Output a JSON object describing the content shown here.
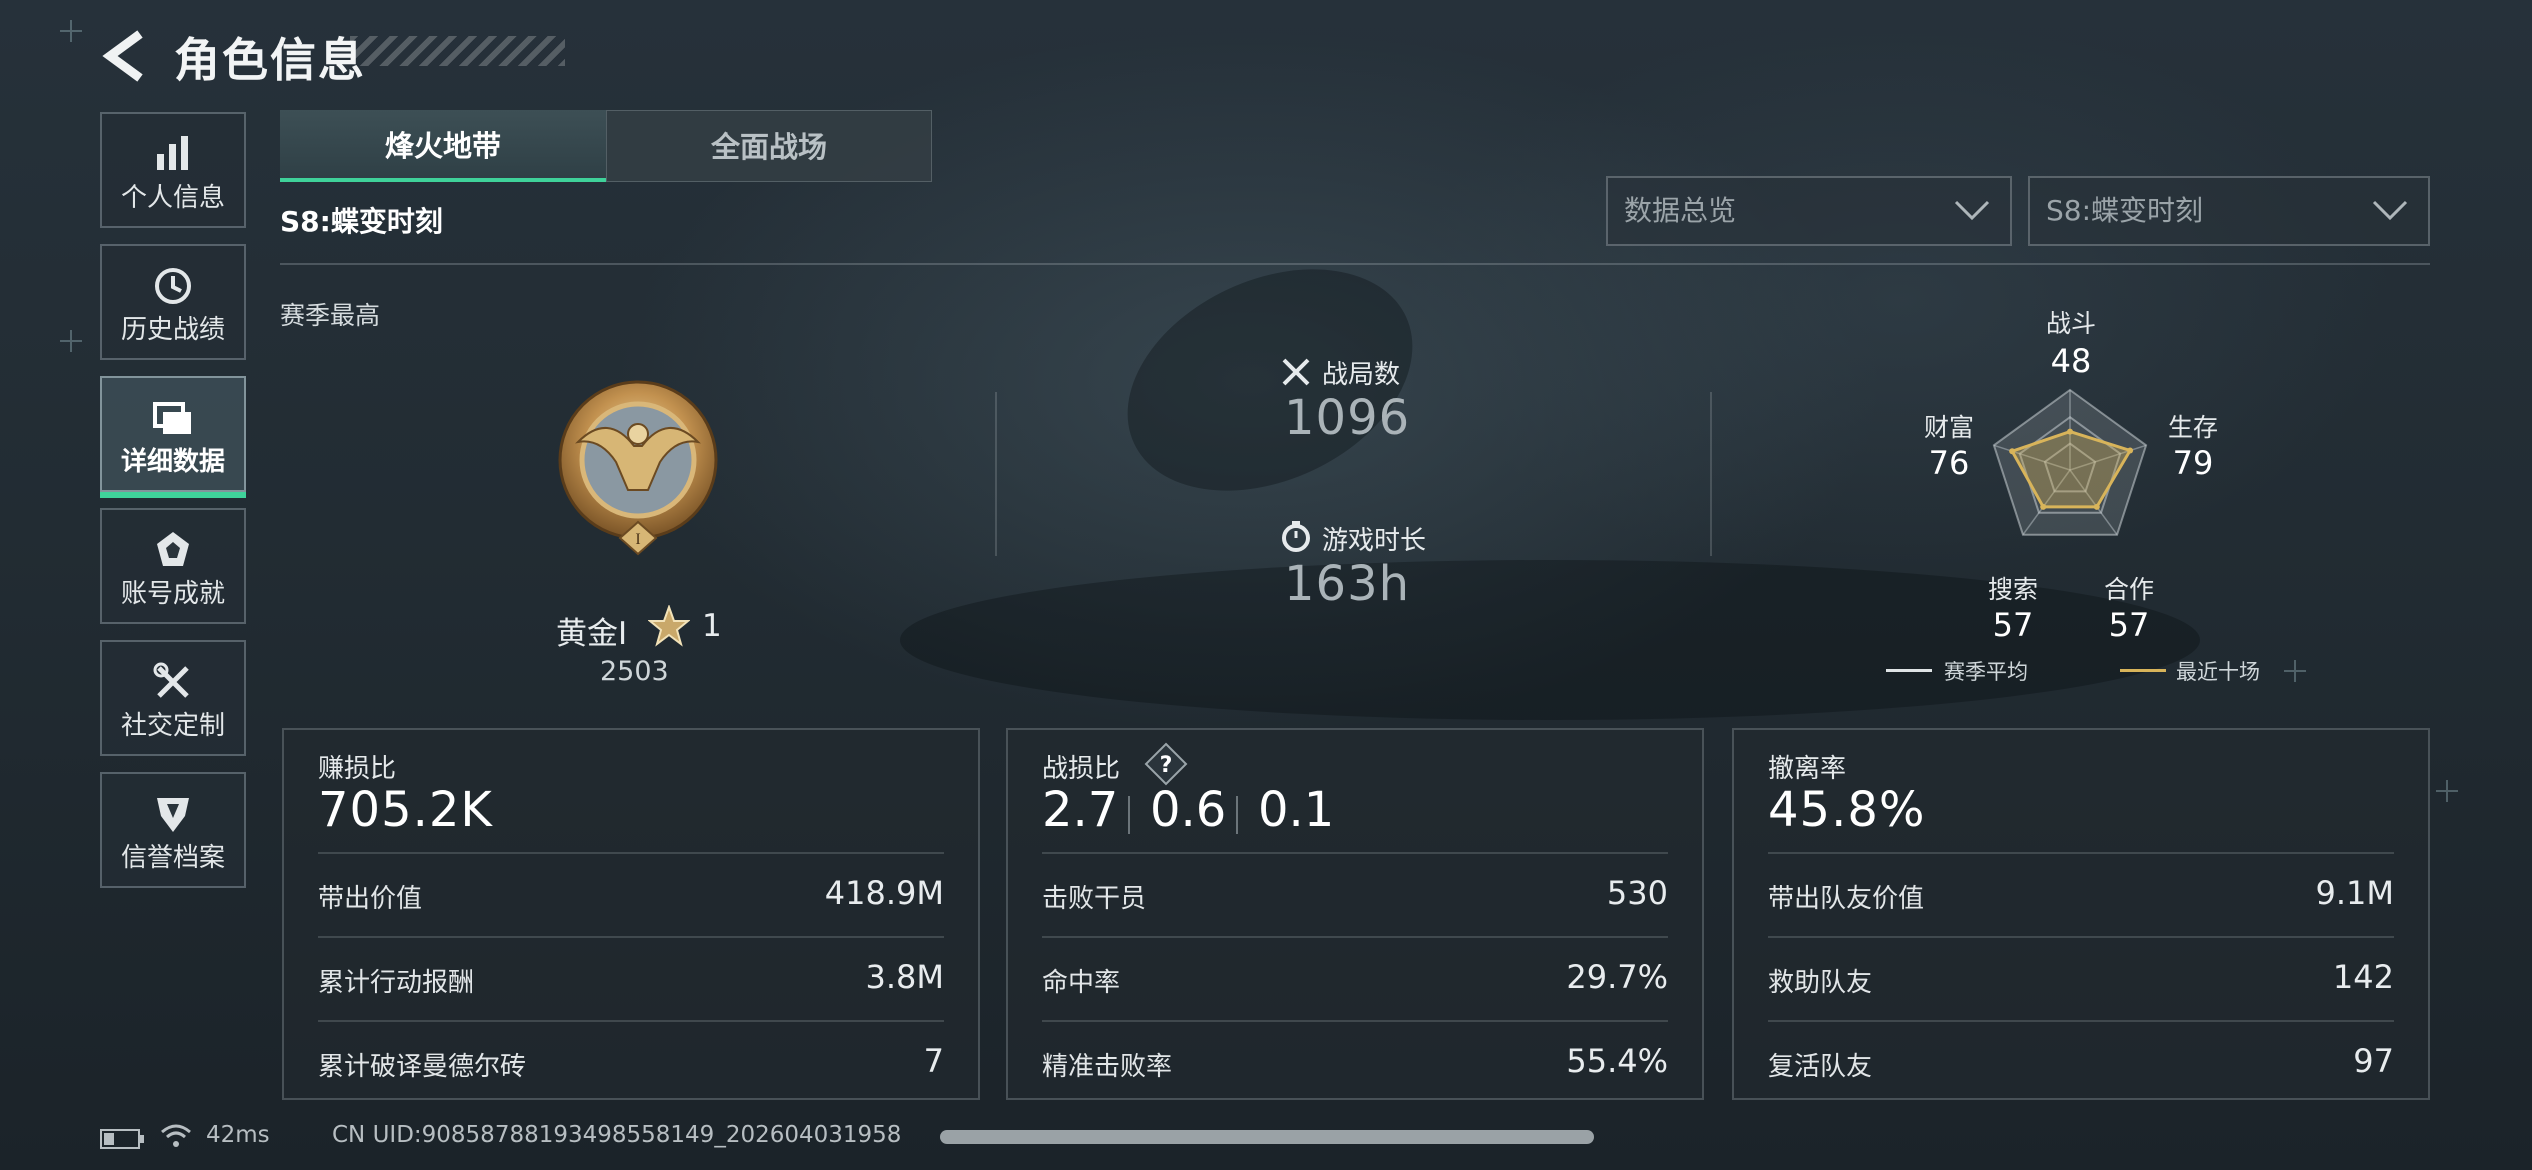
{
  "header": {
    "title": "角色信息"
  },
  "sidebar": {
    "items": [
      {
        "label": "个人信息",
        "icon": "bar-chart-icon"
      },
      {
        "label": "历史战绩",
        "icon": "history-clock-icon"
      },
      {
        "label": "详细数据",
        "icon": "folder-stack-icon",
        "active": true
      },
      {
        "label": "账号成就",
        "icon": "achievement-badge-icon"
      },
      {
        "label": "社交定制",
        "icon": "tools-icon"
      },
      {
        "label": "信誉档案",
        "icon": "shield-profile-icon"
      }
    ]
  },
  "tabs": [
    {
      "label": "烽火地带",
      "active": true
    },
    {
      "label": "全面战场",
      "active": false
    }
  ],
  "season": {
    "title": "S8:蝶变时刻",
    "best_label": "赛季最高"
  },
  "filters": {
    "data_view": "数据总览",
    "season_select": "S8:蝶变时刻"
  },
  "rank": {
    "name": "黄金Ⅰ",
    "stars": "1",
    "points": "2503"
  },
  "stats": {
    "matches_label": "战局数",
    "matches_value": "1096",
    "playtime_label": "游戏时长",
    "playtime_value": "163h"
  },
  "radar": {
    "axes": [
      {
        "label": "战斗",
        "value": 48
      },
      {
        "label": "生存",
        "value": 79
      },
      {
        "label": "合作",
        "value": 57
      },
      {
        "label": "搜索",
        "value": 57
      },
      {
        "label": "财富",
        "value": 76
      }
    ],
    "legend": {
      "season_avg": "赛季平均",
      "recent_ten": "最近十场"
    }
  },
  "cards": {
    "profit": {
      "title": "赚损比",
      "value": "705.2K",
      "rows": [
        {
          "label": "带出价值",
          "value": "418.9M"
        },
        {
          "label": "累计行动报酬",
          "value": "3.8M"
        },
        {
          "label": "累计破译曼德尔砖",
          "value": "7"
        }
      ]
    },
    "kd": {
      "title": "战损比",
      "help": "?",
      "values": [
        "2.7",
        "0.6",
        "0.1"
      ],
      "rows": [
        {
          "label": "击败干员",
          "value": "530"
        },
        {
          "label": "命中率",
          "value": "29.7%"
        },
        {
          "label": "精准击败率",
          "value": "55.4%"
        }
      ]
    },
    "extract": {
      "title": "撤离率",
      "value": "45.8%",
      "rows": [
        {
          "label": "带出队友价值",
          "value": "9.1M"
        },
        {
          "label": "救助队友",
          "value": "142"
        },
        {
          "label": "复活队友",
          "value": "97"
        }
      ]
    }
  },
  "status_bar": {
    "ping": "42ms",
    "uid": "CN UID:90858788193498558149_202604031958"
  },
  "colors": {
    "accent": "#3fd29a",
    "radar_recent": "#d8b45a",
    "radar_avg": "#c9d0d4"
  }
}
